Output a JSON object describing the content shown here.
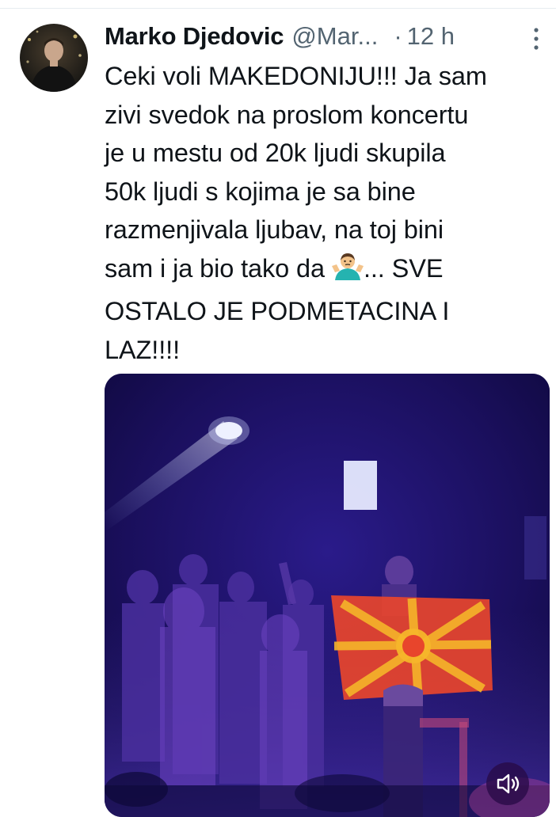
{
  "tweet": {
    "author_name": "Marko Djedovic",
    "handle": "@Mar...",
    "separator": "·",
    "time": "12 h",
    "text_before_emoji": "Ceki voli MAKEDONIJU!!! Ja sam\nzivi svedok na proslom koncertu\nje u mestu od 20k ljudi skupila\n50k ljudi s kojima je sa bine\nrazmenjivala ljubav, na toj bini\nsam i ja bio tako da ",
    "text_after_emoji": "... SVE\nOSTALO JE PODMETACINA I\nLAZ!!!!",
    "emoji": "man-shrugging-emoji",
    "media": {
      "type": "video",
      "description_icon": "concert-video-thumbnail",
      "volume_icon": "speaker-muted-icon"
    }
  },
  "colors": {
    "text_primary": "#0f1419",
    "text_secondary": "#536471",
    "divider": "#e6ecf0",
    "video_background": "#150c4a",
    "flag_red": "#e8452c",
    "flag_yellow": "#f5b52a"
  }
}
